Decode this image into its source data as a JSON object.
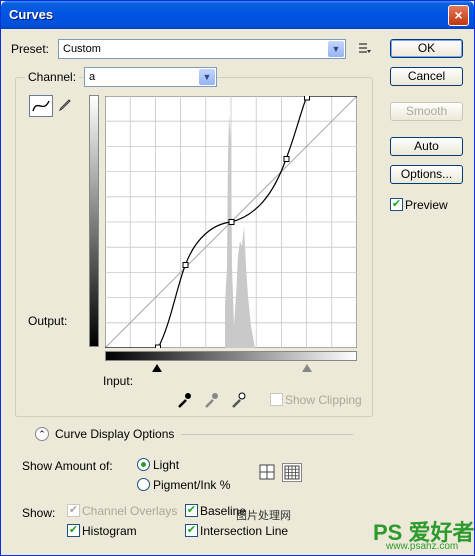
{
  "window": {
    "title": "Curves",
    "close_glyph": "×"
  },
  "preset": {
    "label": "Preset:",
    "value": "Custom"
  },
  "channel": {
    "label": "Channel:",
    "value": "a"
  },
  "buttons": {
    "ok": "OK",
    "cancel": "Cancel",
    "smooth": "Smooth",
    "auto": "Auto",
    "options": "Options..."
  },
  "preview": {
    "label": "Preview",
    "checked": true
  },
  "graph": {
    "output_label": "Output:",
    "input_label": "Input:",
    "control_points": [
      [
        0.21,
        0.0
      ],
      [
        0.32,
        0.33
      ],
      [
        0.5,
        0.5
      ],
      [
        0.72,
        0.75
      ],
      [
        0.8,
        1.0
      ]
    ]
  },
  "show_clipping": {
    "label": "Show Clipping",
    "checked": false
  },
  "curve_display": {
    "label": "Curve Display Options"
  },
  "show_amount": {
    "label": "Show Amount of:",
    "options": [
      "Light",
      "Pigment/Ink %"
    ],
    "selected": "Light"
  },
  "show": {
    "label": "Show:",
    "channel_overlays": "Channel Overlays",
    "baseline": "Baseline",
    "histogram": "Histogram",
    "intersection_line": "Intersection Line"
  },
  "watermark": {
    "text": "PS 爱好者",
    "url": "www.psahz.com",
    "overlay": "图片处理网"
  },
  "colors": {
    "accent": "#0054e3",
    "check": "#21a121",
    "face": "#ece9d8"
  }
}
